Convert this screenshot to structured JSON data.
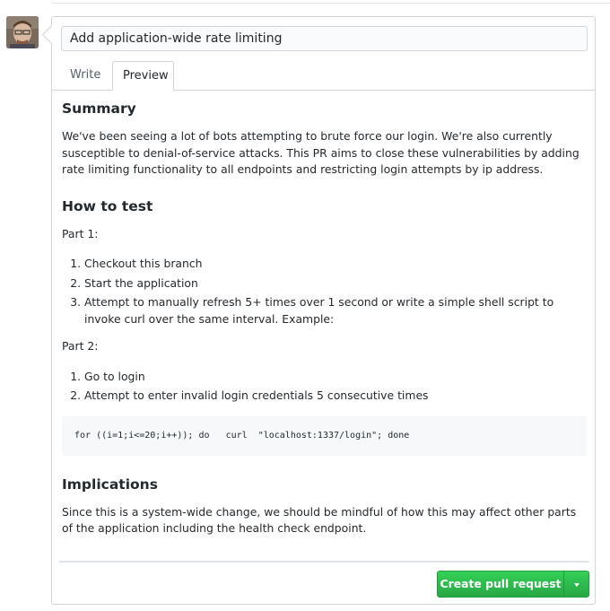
{
  "pr": {
    "title_value": "Add application-wide rate limiting",
    "tabs": [
      {
        "label": "Write"
      },
      {
        "label": "Preview"
      }
    ]
  },
  "preview": {
    "summary_heading": "Summary",
    "summary_text": "We've been seeing a lot of bots attempting to brute force our login. We're also currently susceptible to denial-of-service attacks. This PR aims to close these vulnerabilities by adding rate limiting functionality to all endpoints and restricting login attempts by ip address.",
    "test_heading": "How to test",
    "part1_label": "Part 1:",
    "part1_steps": [
      "Checkout this branch",
      "Start the application",
      "Attempt to manually refresh 5+ times over 1 second or write a simple shell script to invoke curl over the same interval. Example:"
    ],
    "part2_label": "Part 2:",
    "part2_steps": [
      "Go to login",
      "Attempt to enter invalid login credentials 5 consecutive times"
    ],
    "code": "for ((i=1;i<=20;i++)); do   curl  \"localhost:1337/login\"; done",
    "implications_heading": "Implications",
    "implications_text": "Since this is a system-wide change, we should be mindful of how this may affect other parts of the application including the health check endpoint."
  },
  "actions": {
    "create_label": "Create pull request"
  },
  "colors": {
    "accent": "#28a745",
    "border": "#d1d5da"
  },
  "icons": {
    "avatar": "avatar",
    "dropdown": "chevron-down-icon"
  }
}
